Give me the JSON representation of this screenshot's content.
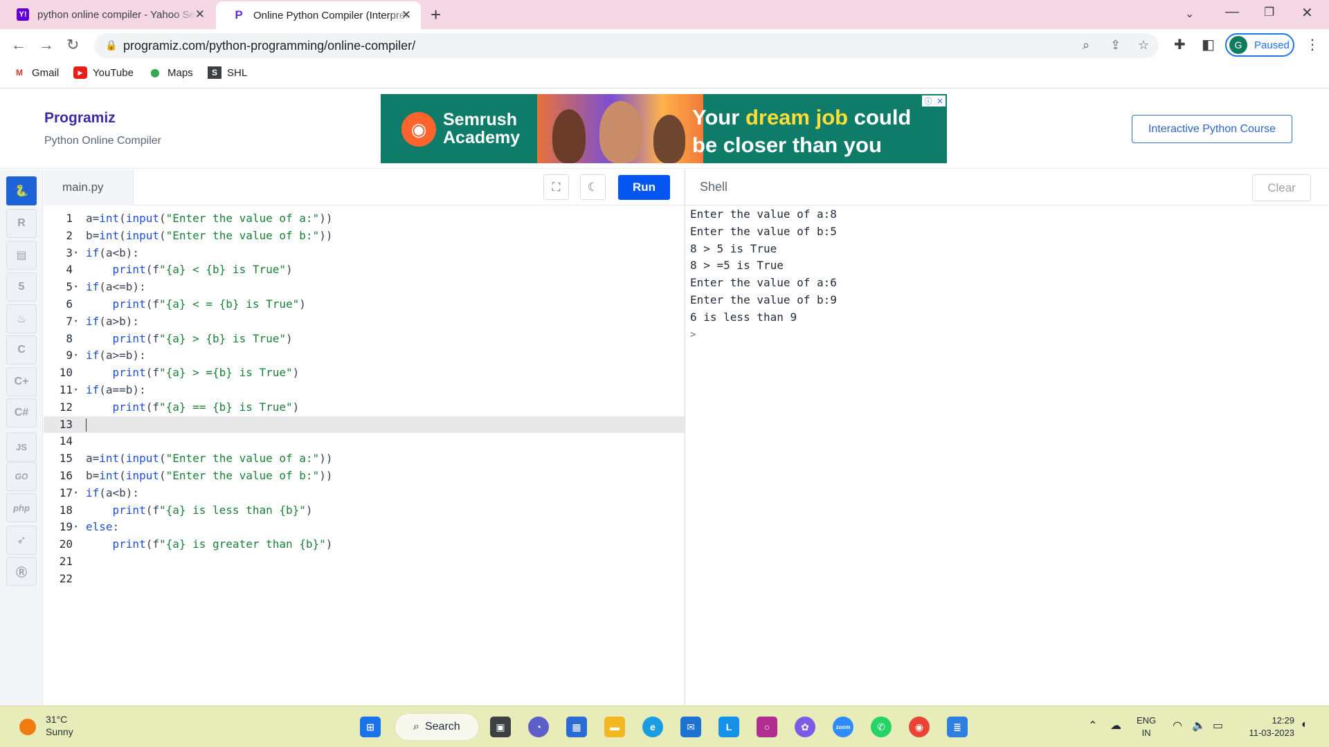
{
  "browser": {
    "tabs": [
      {
        "title": "python online compiler - Yahoo Search Results",
        "favicon": "Y!",
        "active": false
      },
      {
        "title": "Online Python Compiler (Interpreter)",
        "favicon": "P",
        "active": true
      }
    ],
    "url": "programiz.com/python-programming/online-compiler/",
    "profile_initial": "G",
    "profile_status": "Paused",
    "bookmarks": [
      "Gmail",
      "YouTube",
      "Maps",
      "SHL"
    ]
  },
  "site": {
    "logo": "Programiz",
    "subtitle": "Python Online Compiler",
    "course_button": "Interactive Python Course",
    "ad": {
      "brand_line1": "Semrush",
      "brand_line2": "Academy",
      "tag_before": "Your ",
      "tag_highlight": "dream job",
      "tag_after": " could be closer than you think!"
    }
  },
  "rail": {
    "items": [
      "python-icon",
      "r-icon",
      "sql-icon",
      "html5-icon",
      "java-icon",
      "c-icon",
      "cplusplus-icon",
      "csharp-icon",
      "JS",
      "GO",
      "php",
      "swift-icon",
      "rust-icon"
    ]
  },
  "editor": {
    "filename": "main.py",
    "run_label": "Run",
    "active_line": 13,
    "lines": [
      {
        "n": "1",
        "fold": "",
        "code": "a=int(input(\"Enter the value of a:\"))"
      },
      {
        "n": "2",
        "fold": "",
        "code": "b=int(input(\"Enter the value of b:\"))"
      },
      {
        "n": "3",
        "fold": "▾",
        "code": "if(a<b):"
      },
      {
        "n": "4",
        "fold": "",
        "code": "    print(f\"{a} < {b} is True\")"
      },
      {
        "n": "5",
        "fold": "▾",
        "code": "if(a<=b):"
      },
      {
        "n": "6",
        "fold": "",
        "code": "    print(f\"{a} < = {b} is True\")"
      },
      {
        "n": "7",
        "fold": "▾",
        "code": "if(a>b):"
      },
      {
        "n": "8",
        "fold": "",
        "code": "    print(f\"{a} > {b} is True\")"
      },
      {
        "n": "9",
        "fold": "▾",
        "code": "if(a>=b):"
      },
      {
        "n": "10",
        "fold": "",
        "code": "    print(f\"{a} > ={b} is True\")"
      },
      {
        "n": "11",
        "fold": "▾",
        "code": "if(a==b):"
      },
      {
        "n": "12",
        "fold": "",
        "code": "    print(f\"{a} == {b} is True\")"
      },
      {
        "n": "13",
        "fold": "",
        "code": ""
      },
      {
        "n": "14",
        "fold": "",
        "code": ""
      },
      {
        "n": "15",
        "fold": "",
        "code": "a=int(input(\"Enter the value of a:\"))"
      },
      {
        "n": "16",
        "fold": "",
        "code": "b=int(input(\"Enter the value of b:\"))"
      },
      {
        "n": "17",
        "fold": "▾",
        "code": "if(a<b):"
      },
      {
        "n": "18",
        "fold": "",
        "code": "    print(f\"{a} is less than {b}\")"
      },
      {
        "n": "19",
        "fold": "▾",
        "code": "else:"
      },
      {
        "n": "20",
        "fold": "",
        "code": "    print(f\"{a} is greater than {b}\")"
      },
      {
        "n": "21",
        "fold": "",
        "code": ""
      },
      {
        "n": "22",
        "fold": "",
        "code": ""
      }
    ]
  },
  "shell": {
    "title": "Shell",
    "clear_label": "Clear",
    "output": [
      "Enter the value of a:8",
      "Enter the value of b:5",
      "8 > 5 is True",
      "8 > =5 is True",
      "Enter the value of a:6",
      "Enter the value of b:9",
      "6 is less than 9"
    ],
    "prompt": ">"
  },
  "taskbar": {
    "temperature": "31°C",
    "condition": "Sunny",
    "search_label": "Search",
    "lang_line1": "ENG",
    "lang_line2": "IN",
    "time": "12:29",
    "date": "11-03-2023"
  },
  "colors": {
    "accent": "#0556f3",
    "tabbar": "#f4d7e3",
    "taskbar": "#e7ecb8",
    "ad_bg": "#0f7c6a"
  }
}
